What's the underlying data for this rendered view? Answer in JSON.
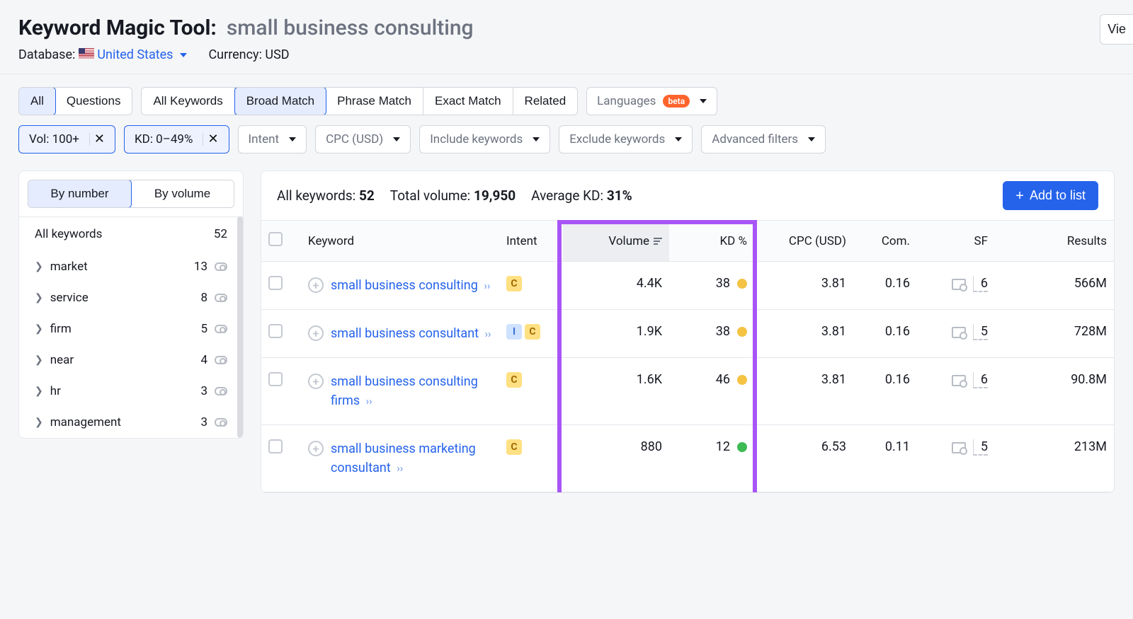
{
  "header": {
    "tool_name": "Keyword Magic Tool:",
    "query": "small business consulting",
    "database_label": "Database:",
    "database_value": "United States",
    "currency_label": "Currency:",
    "currency_value": "USD",
    "view_button": "Vie"
  },
  "filters": {
    "mode": {
      "all": "All",
      "questions": "Questions"
    },
    "match": {
      "all_kw": "All Keywords",
      "broad": "Broad Match",
      "phrase": "Phrase Match",
      "exact": "Exact Match",
      "related": "Related"
    },
    "lang_label": "Languages",
    "lang_badge": "beta",
    "vol_chip": "Vol: 100+",
    "kd_chip": "KD: 0–49%",
    "intent_label": "Intent",
    "cpc_label": "CPC (USD)",
    "include_label": "Include keywords",
    "exclude_label": "Exclude keywords",
    "advanced_label": "Advanced filters"
  },
  "sidebar": {
    "by_number": "By number",
    "by_volume": "By volume",
    "all_label": "All keywords",
    "all_count": "52",
    "groups": [
      {
        "label": "market",
        "count": "13"
      },
      {
        "label": "service",
        "count": "8"
      },
      {
        "label": "firm",
        "count": "5"
      },
      {
        "label": "near",
        "count": "4"
      },
      {
        "label": "hr",
        "count": "3"
      },
      {
        "label": "management",
        "count": "3"
      }
    ]
  },
  "summary": {
    "all_kw_label": "All keywords:",
    "all_kw_value": "52",
    "total_vol_label": "Total volume:",
    "total_vol_value": "19,950",
    "avg_kd_label": "Average KD:",
    "avg_kd_value": "31%",
    "add_button": "Add to list"
  },
  "columns": {
    "keyword": "Keyword",
    "intent": "Intent",
    "volume": "Volume",
    "kd": "KD %",
    "cpc": "CPC (USD)",
    "com": "Com.",
    "sf": "SF",
    "results": "Results"
  },
  "rows": [
    {
      "kw": "small business consulting",
      "intents": [
        "C"
      ],
      "vol": "4.4K",
      "kd": "38",
      "kd_color": "yellow",
      "cpc": "3.81",
      "com": "0.16",
      "sf": "6",
      "results": "566M"
    },
    {
      "kw": "small business consultant",
      "intents": [
        "I",
        "C"
      ],
      "vol": "1.9K",
      "kd": "38",
      "kd_color": "yellow",
      "cpc": "3.81",
      "com": "0.16",
      "sf": "5",
      "results": "728M"
    },
    {
      "kw": "small business consulting firms",
      "intents": [
        "C"
      ],
      "vol": "1.6K",
      "kd": "46",
      "kd_color": "yellow",
      "cpc": "3.81",
      "com": "0.16",
      "sf": "6",
      "results": "90.8M"
    },
    {
      "kw": "small business marketing consultant",
      "intents": [
        "C"
      ],
      "vol": "880",
      "kd": "12",
      "kd_color": "green",
      "cpc": "6.53",
      "com": "0.11",
      "sf": "5",
      "results": "213M"
    }
  ]
}
